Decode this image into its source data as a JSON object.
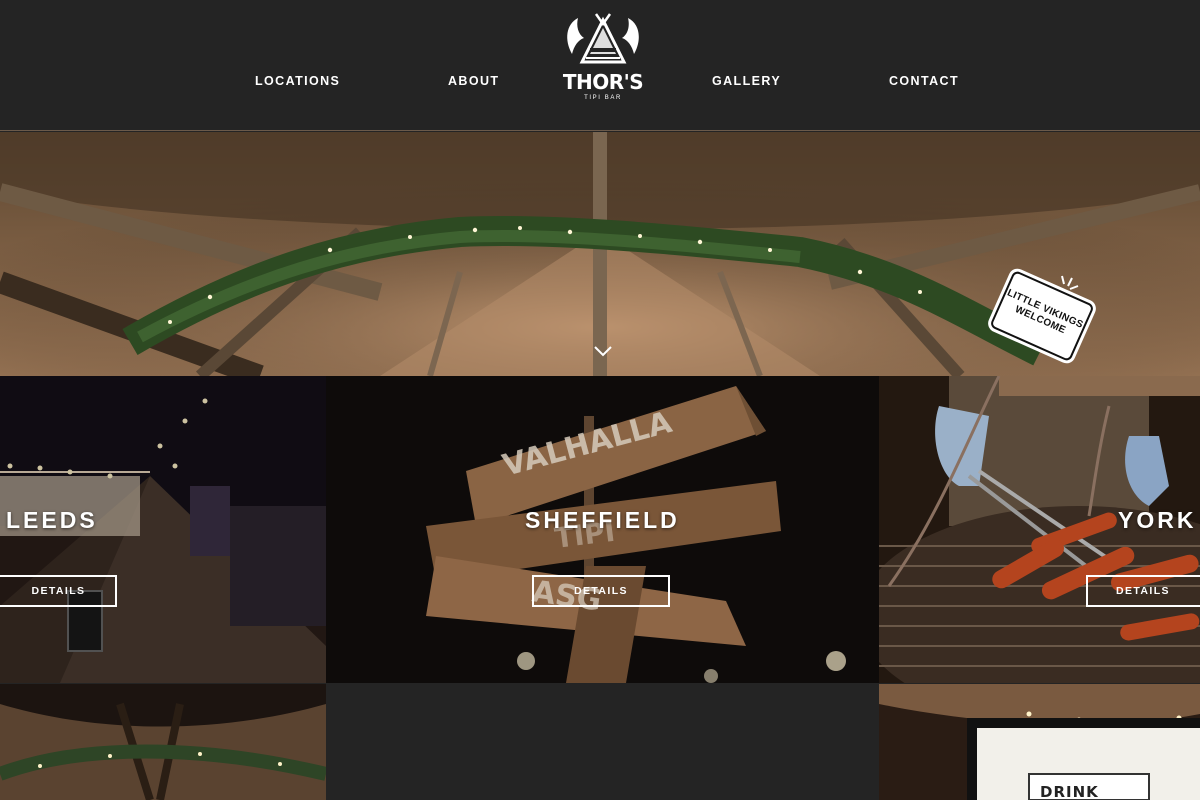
{
  "nav": {
    "locations": "LOCATIONS",
    "about": "ABOUT",
    "gallery": "GALLERY",
    "contact": "CONTACT"
  },
  "logo": {
    "title": "THOR'S",
    "subtitle": "TIPI BAR"
  },
  "hero": {
    "badge_line1": "LITTLE VIKINGS",
    "badge_line2": "WELCOME",
    "scroll_icon": "chevron-down-icon"
  },
  "locations": [
    {
      "name": "LEEDS",
      "button": "DETAILS"
    },
    {
      "name": "SHEFFIELD",
      "button": "DETAILS"
    },
    {
      "name": "YORK",
      "button": "DETAILS"
    }
  ],
  "signs": {
    "valhalla": "VALHALLA",
    "tipi": "TIPI",
    "asgard": "ASG",
    "drink": "DRINK"
  },
  "colors": {
    "header_bg": "#242424",
    "text": "#ffffff",
    "divider": "#6b5a4a"
  }
}
